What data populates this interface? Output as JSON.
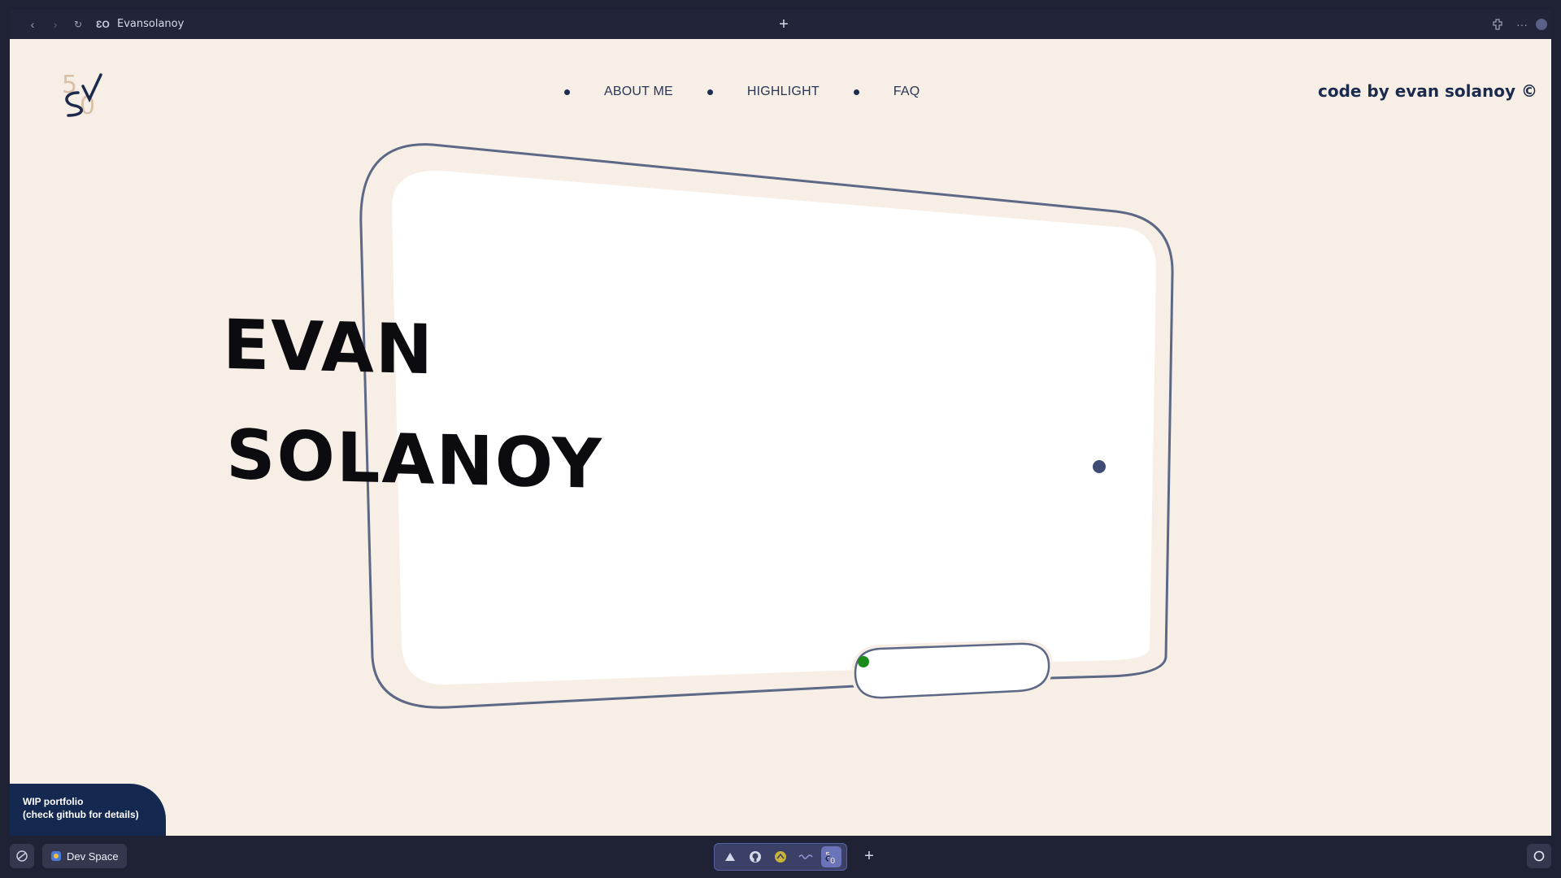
{
  "browser": {
    "tab_title": "Evansolanoy",
    "new_tab_label": "+",
    "more_label": "···"
  },
  "header": {
    "nav": [
      {
        "label": "ABOUT ME"
      },
      {
        "label": "HIGHLIGHT"
      },
      {
        "label": "FAQ"
      }
    ],
    "credit": "code by evan solanoy ©"
  },
  "hero": {
    "first_name": "EVAN",
    "last_name": "SOLANOY"
  },
  "badge": {
    "line1": "WIP portfolio",
    "line2": "(check github for details)"
  },
  "taskbar": {
    "space_label": "Dev Space",
    "plus_label": "+"
  },
  "colors": {
    "page_bg": "#f7efe5",
    "navy": "#142850",
    "frame_stroke": "#5c6886",
    "status_dot": "#1a8a1a"
  }
}
